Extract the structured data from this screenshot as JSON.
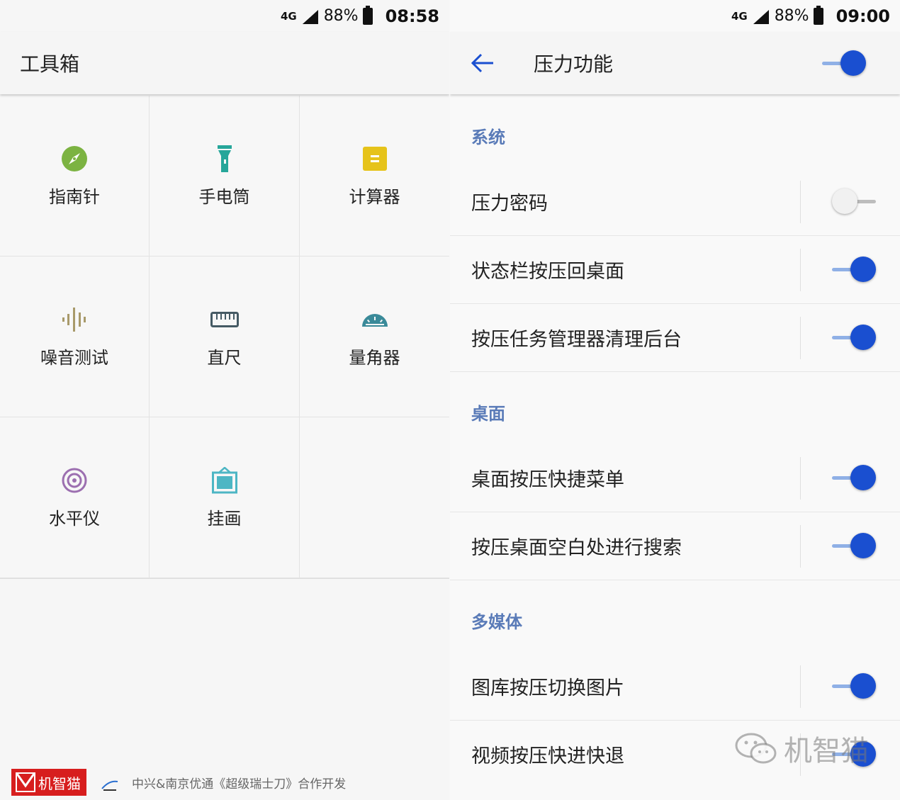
{
  "left": {
    "status": {
      "net": "4G",
      "net_small": "4G",
      "battery": "88%",
      "time": "08:58"
    },
    "title": "工具箱",
    "tools": [
      {
        "label": "指南针",
        "icon": "compass-icon",
        "color": "#7cb342"
      },
      {
        "label": "手电筒",
        "icon": "flashlight-icon",
        "color": "#26a69a"
      },
      {
        "label": "计算器",
        "icon": "calculator-icon",
        "color": "#e6c31a"
      },
      {
        "label": "噪音测试",
        "icon": "sound-wave-icon",
        "color": "#a89a6a"
      },
      {
        "label": "直尺",
        "icon": "ruler-icon",
        "color": "#455a64"
      },
      {
        "label": "量角器",
        "icon": "protractor-icon",
        "color": "#3a8a99"
      },
      {
        "label": "水平仪",
        "icon": "level-target-icon",
        "color": "#9c6fb0"
      },
      {
        "label": "挂画",
        "icon": "picture-frame-icon",
        "color": "#4db6c4"
      }
    ],
    "footer": {
      "logo_text": "机智猫",
      "text": "中兴&南京优通《超级瑞士刀》合作开发"
    }
  },
  "right": {
    "status": {
      "net": "4G",
      "net_small": "4G",
      "battery": "88%",
      "time": "09:00"
    },
    "title": "压力功能",
    "master_toggle": true,
    "sections": [
      {
        "header": "系统",
        "items": [
          {
            "label": "压力密码",
            "on": false
          },
          {
            "label": "状态栏按压回桌面",
            "on": true
          },
          {
            "label": "按压任务管理器清理后台",
            "on": true
          }
        ]
      },
      {
        "header": "桌面",
        "items": [
          {
            "label": "桌面按压快捷菜单",
            "on": true
          },
          {
            "label": "按压桌面空白处进行搜索",
            "on": true
          }
        ]
      },
      {
        "header": "多媒体",
        "items": [
          {
            "label": "图库按压切换图片",
            "on": true
          },
          {
            "label": "视频按压快进快退",
            "on": true
          }
        ]
      }
    ],
    "watermark": "机智猫"
  }
}
